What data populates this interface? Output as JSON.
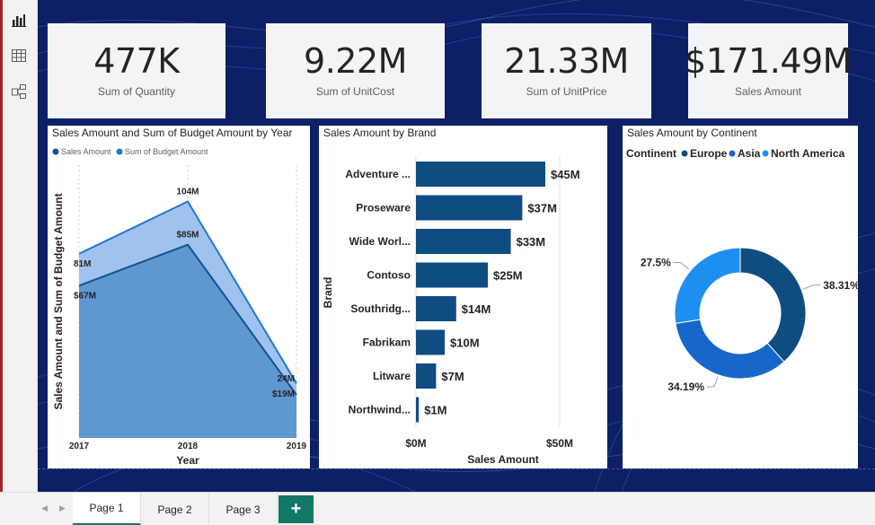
{
  "rail": {
    "items": [
      {
        "name": "report-view-icon",
        "active": true
      },
      {
        "name": "data-view-icon",
        "active": false
      },
      {
        "name": "model-view-icon",
        "active": false
      }
    ]
  },
  "kpis": [
    {
      "value": "477K",
      "label": "Sum of Quantity"
    },
    {
      "value": "9.22M",
      "label": "Sum of UnitCost"
    },
    {
      "value": "21.33M",
      "label": "Sum of UnitPrice"
    },
    {
      "value": "$171.49M",
      "label": "Sales Amount"
    }
  ],
  "area_chart": {
    "title": "Sales Amount and Sum of Budget Amount by Year",
    "legend": [
      "Sales Amount",
      "Sum of Budget Amount"
    ],
    "ylabel": "Sales Amount and Sum of Budget Amount",
    "xlabel": "Year",
    "ticks": [
      "2017",
      "2018",
      "2019"
    ],
    "labels": {
      "budget": [
        "81M",
        "104M",
        "24M"
      ],
      "sales": [
        "$67M",
        "$85M",
        "$19M"
      ]
    }
  },
  "bar_chart": {
    "title": "Sales Amount by Brand",
    "ylabel": "Brand",
    "xlabel": "Sales Amount",
    "xticks": [
      "$0M",
      "$50M"
    ]
  },
  "donut_chart": {
    "title": "Sales Amount by Continent",
    "legend_title": "Continent",
    "legend": [
      "Europe",
      "Asia",
      "North America"
    ]
  },
  "chart_data": [
    {
      "type": "area",
      "title": "Sales Amount and Sum of Budget Amount by Year",
      "xlabel": "Year",
      "ylabel": "Sales Amount and Sum of Budget Amount",
      "categories": [
        "2017",
        "2018",
        "2019"
      ],
      "series": [
        {
          "name": "Sales Amount",
          "values": [
            67,
            85,
            19
          ],
          "color": "#12518f"
        },
        {
          "name": "Sum of Budget Amount",
          "values": [
            81,
            104,
            24
          ],
          "color": "#1f77d4"
        }
      ],
      "ylim": [
        0,
        120
      ]
    },
    {
      "type": "bar",
      "orientation": "horizontal",
      "title": "Sales Amount by Brand",
      "xlabel": "Sales Amount",
      "ylabel": "Brand",
      "categories": [
        "Adventure ...",
        "Proseware",
        "Wide Worl...",
        "Contoso",
        "Southridg...",
        "Fabrikam",
        "Litware",
        "Northwind..."
      ],
      "values": [
        45,
        37,
        33,
        25,
        14,
        10,
        7,
        1
      ],
      "data_labels": [
        "$45M",
        "$37M",
        "$33M",
        "$25M",
        "$14M",
        "$10M",
        "$7M",
        "$1M"
      ],
      "xlim": [
        0,
        50
      ],
      "color": "#0f4c81",
      "grid": true
    },
    {
      "type": "pie",
      "donut": true,
      "title": "Sales Amount by Continent",
      "categories": [
        "Europe",
        "Asia",
        "North America"
      ],
      "values": [
        38.31,
        34.19,
        27.5
      ],
      "data_labels": [
        "38.31%",
        "34.19%",
        "27.5%"
      ],
      "colors": [
        "#0f4c81",
        "#1766c9",
        "#1d8ff0"
      ],
      "legend_position": "top-left"
    }
  ],
  "tabs": {
    "pages": [
      {
        "label": "Page 1",
        "active": true
      },
      {
        "label": "Page 2",
        "active": false
      },
      {
        "label": "Page 3",
        "active": false
      }
    ],
    "add_label": "+"
  }
}
